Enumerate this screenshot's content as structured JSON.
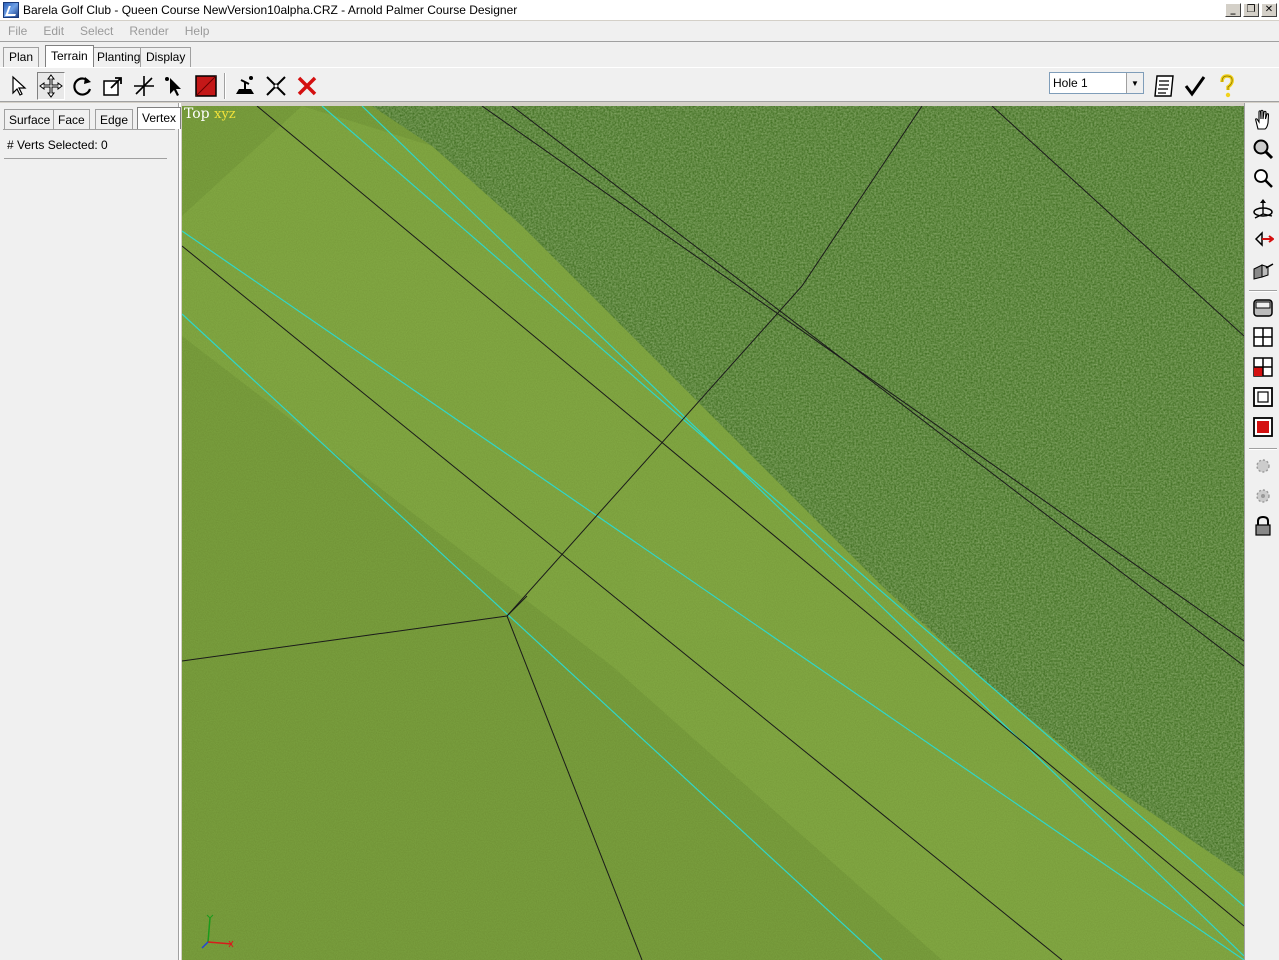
{
  "window": {
    "title": "Barela Golf Club - Queen Course NewVersion10alpha.CRZ - Arnold Palmer Course Designer",
    "minimize_glyph": "_",
    "restore_glyph": "❐",
    "close_glyph": "✕"
  },
  "menu": [
    "File",
    "Edit",
    "Select",
    "Render",
    "Help"
  ],
  "main_tabs": [
    "Plan",
    "Terrain",
    "Planting",
    "Display"
  ],
  "active_main_tab": "Terrain",
  "toolbar": {
    "tools": [
      "select-arrow-icon",
      "move-icon",
      "rotate-icon",
      "scale-icon",
      "split-icon",
      "vertex-pick-icon",
      "red-square-icon",
      "paint-tool-icon",
      "delete-x-icon",
      "red-x-icon"
    ],
    "hole_select": {
      "value": "Hole 1"
    },
    "right_icons": [
      "list-icon",
      "checkmark-icon",
      "help-icon"
    ]
  },
  "sub_tabs": [
    "Surface",
    "Face",
    "Edge",
    "Vertex"
  ],
  "active_sub_tab": "Vertex",
  "panel": {
    "verts_selected": "# Verts Selected: 0"
  },
  "viewport": {
    "view_name": "Top",
    "axis_label": "xyz"
  },
  "right_tools": [
    "hand-pan-icon",
    "zoom-icon",
    "zoom-extents-icon",
    "orbit-icon",
    "camera-move-icon",
    "camera-icon",
    "render-view-icon",
    "quad-view-icon",
    "red-quad-view-icon",
    "frame-icon",
    "red-frame-icon",
    "light-icon",
    "light-2-icon",
    "lock-icon"
  ],
  "colors": {
    "grass_light": "#79a03e",
    "grass_dark": "#3f6b1f",
    "guide_line": "#2fd7c9",
    "mesh_edge": "#1a1a1a"
  }
}
